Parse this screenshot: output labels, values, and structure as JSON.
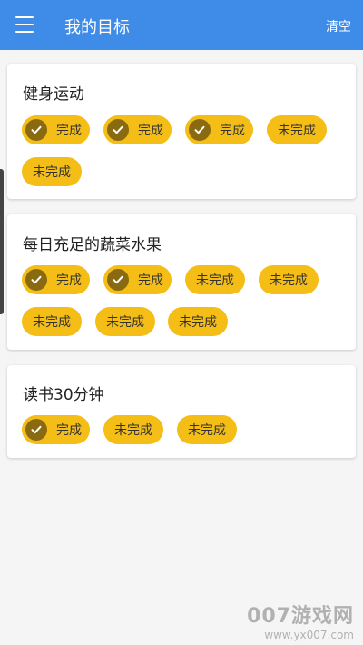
{
  "appbar": {
    "title": "我的目标",
    "clear_label": "清空"
  },
  "goals": [
    {
      "title": "健身运动",
      "chips": [
        {
          "label": "完成",
          "done": true
        },
        {
          "label": "完成",
          "done": true
        },
        {
          "label": "完成",
          "done": true
        },
        {
          "label": "未完成",
          "done": false
        },
        {
          "label": "未完成",
          "done": false
        }
      ]
    },
    {
      "title": "每日充足的蔬菜水果",
      "chips": [
        {
          "label": "完成",
          "done": true
        },
        {
          "label": "完成",
          "done": true
        },
        {
          "label": "未完成",
          "done": false
        },
        {
          "label": "未完成",
          "done": false
        },
        {
          "label": "未完成",
          "done": false
        },
        {
          "label": "未完成",
          "done": false
        },
        {
          "label": "未完成",
          "done": false
        }
      ]
    },
    {
      "title": "读书30分钟",
      "chips": [
        {
          "label": "完成",
          "done": true
        },
        {
          "label": "未完成",
          "done": false
        },
        {
          "label": "未完成",
          "done": false
        }
      ]
    }
  ],
  "watermark": {
    "logo": "007游戏网",
    "url": "www.yx007.com"
  },
  "colors": {
    "appbar": "#3f8be8",
    "chip": "#f5be16",
    "check": "#8a6a10"
  }
}
